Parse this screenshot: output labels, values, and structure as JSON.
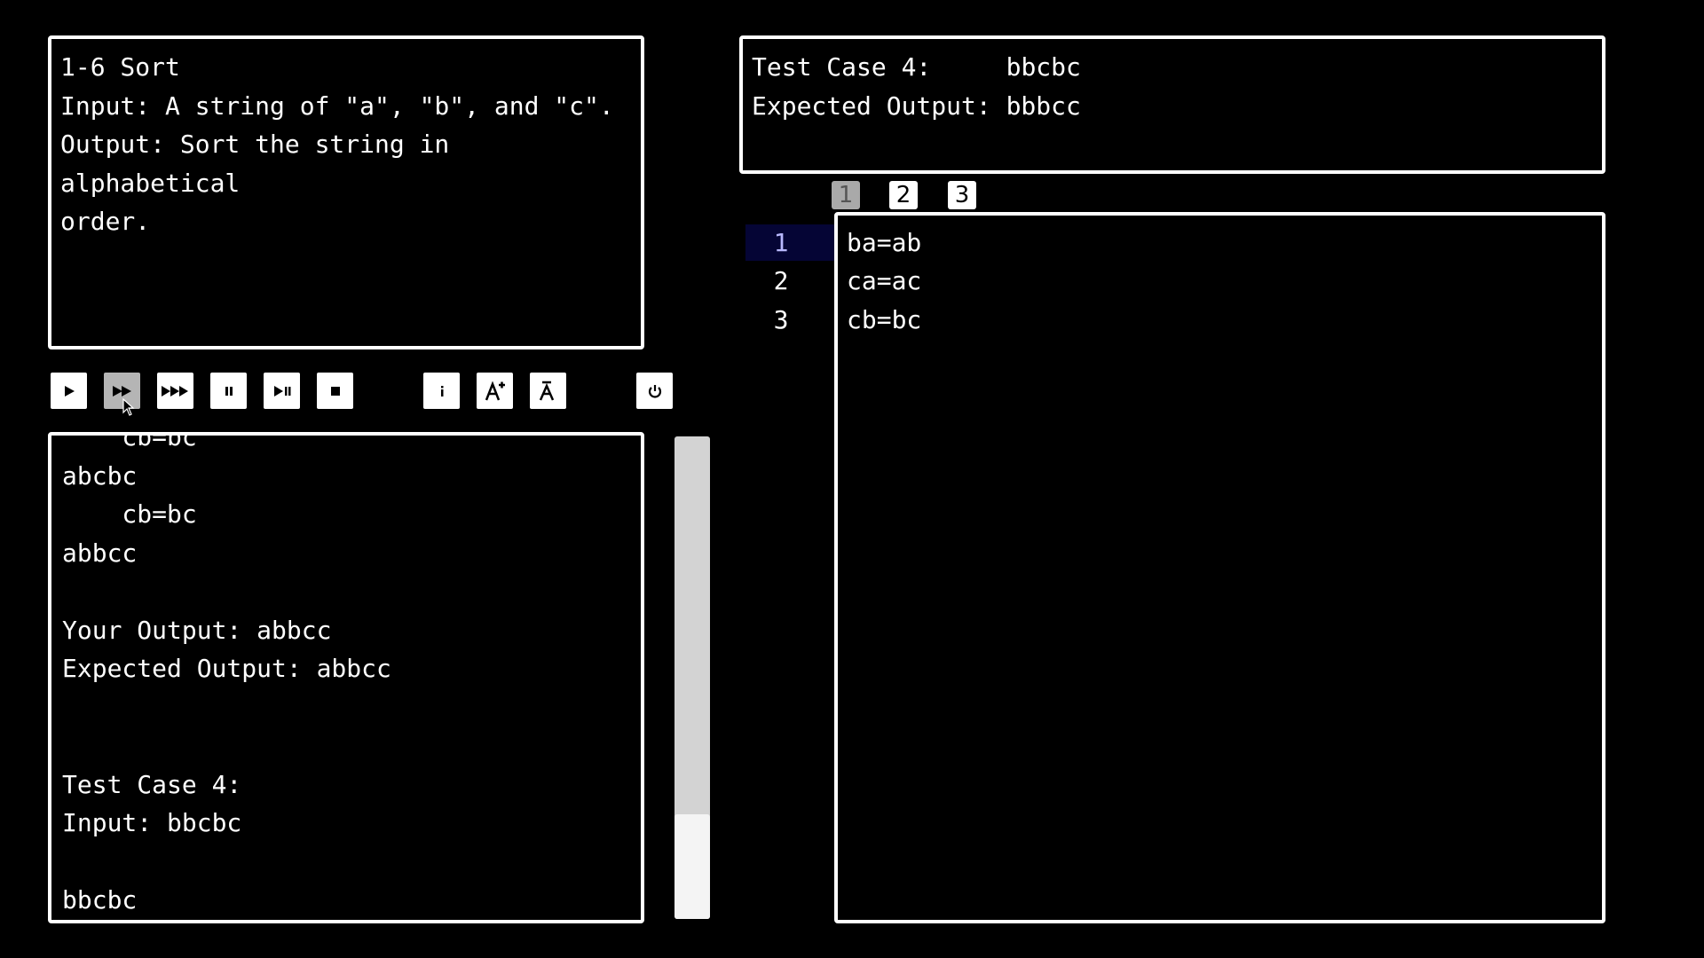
{
  "problem": {
    "lines": [
      "1-6 Sort",
      "Input: A string of \"a\", \"b\", and \"c\".",
      "Output: Sort the string in alphabetical",
      "order."
    ]
  },
  "toolbar": {
    "buttons": [
      {
        "name": "play-button",
        "icon": "play-icon",
        "active": false
      },
      {
        "name": "fast-forward-button",
        "icon": "fast-forward-icon",
        "active": true
      },
      {
        "name": "fastest-forward-button",
        "icon": "triple-play-icon",
        "active": false
      },
      {
        "name": "pause-button",
        "icon": "pause-icon",
        "active": false
      },
      {
        "name": "step-button",
        "icon": "step-icon",
        "active": false
      },
      {
        "name": "stop-button",
        "icon": "stop-icon",
        "active": false
      },
      {
        "name": "info-button",
        "icon": "info-icon",
        "active": false
      },
      {
        "name": "font-increase-button",
        "icon": "font-increase-icon",
        "active": false
      },
      {
        "name": "font-decrease-button",
        "icon": "font-decrease-icon",
        "active": false
      },
      {
        "name": "power-button",
        "icon": "power-icon",
        "active": false
      }
    ]
  },
  "console": {
    "lines": [
      "    cb=bc",
      "abcbc",
      "    cb=bc",
      "abbcc",
      "",
      "Your Output: abbcc",
      "Expected Output: abbcc",
      "",
      "",
      "Test Case 4:",
      "Input: bbcbc",
      "",
      "bbcbc"
    ]
  },
  "scrollbar": {
    "position": 0.85
  },
  "testcase": {
    "label": "Test Case 4:",
    "input": "bbcbc",
    "expected_label": "Expected Output:",
    "expected": "bbbcc"
  },
  "tabs": [
    {
      "label": "1",
      "active": true
    },
    {
      "label": "2",
      "active": false
    },
    {
      "label": "3",
      "active": false
    }
  ],
  "editor": {
    "current_line": 1,
    "lines": [
      {
        "num": "1",
        "code": "ba=ab"
      },
      {
        "num": "2",
        "code": "ca=ac"
      },
      {
        "num": "3",
        "code": "cb=bc"
      }
    ]
  },
  "colors": {
    "background": "#000000",
    "panel_border": "#ffffff",
    "current_line_bg": "#050535",
    "current_line_num": "#b8b8ff",
    "active_button": "#b5b5b5",
    "scroll_track": "#d3d3d3",
    "scroll_thumb": "#f4f4f4"
  }
}
